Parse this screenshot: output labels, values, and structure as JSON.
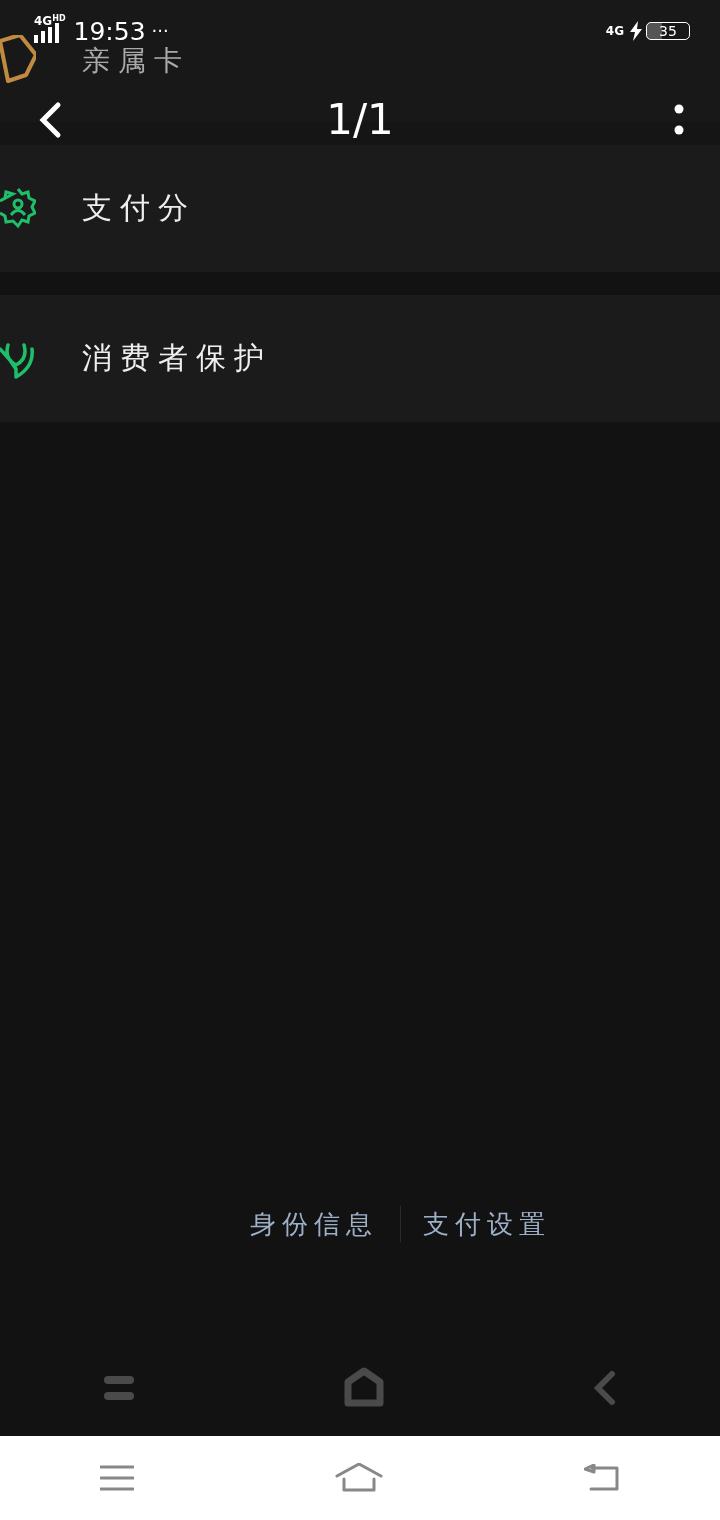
{
  "status_bar": {
    "network": "4G",
    "network_badge": "HD",
    "time": "19:53",
    "more": "···",
    "right_network": "4G",
    "battery": "35",
    "charging": true
  },
  "partial_row": {
    "label": "亲属卡"
  },
  "header": {
    "title": "1/1"
  },
  "items": [
    {
      "label": "支付分",
      "kind": "score"
    },
    {
      "label": "消费者保护",
      "kind": "protect"
    }
  ],
  "footer_links": [
    "身份信息",
    "支付设置"
  ]
}
